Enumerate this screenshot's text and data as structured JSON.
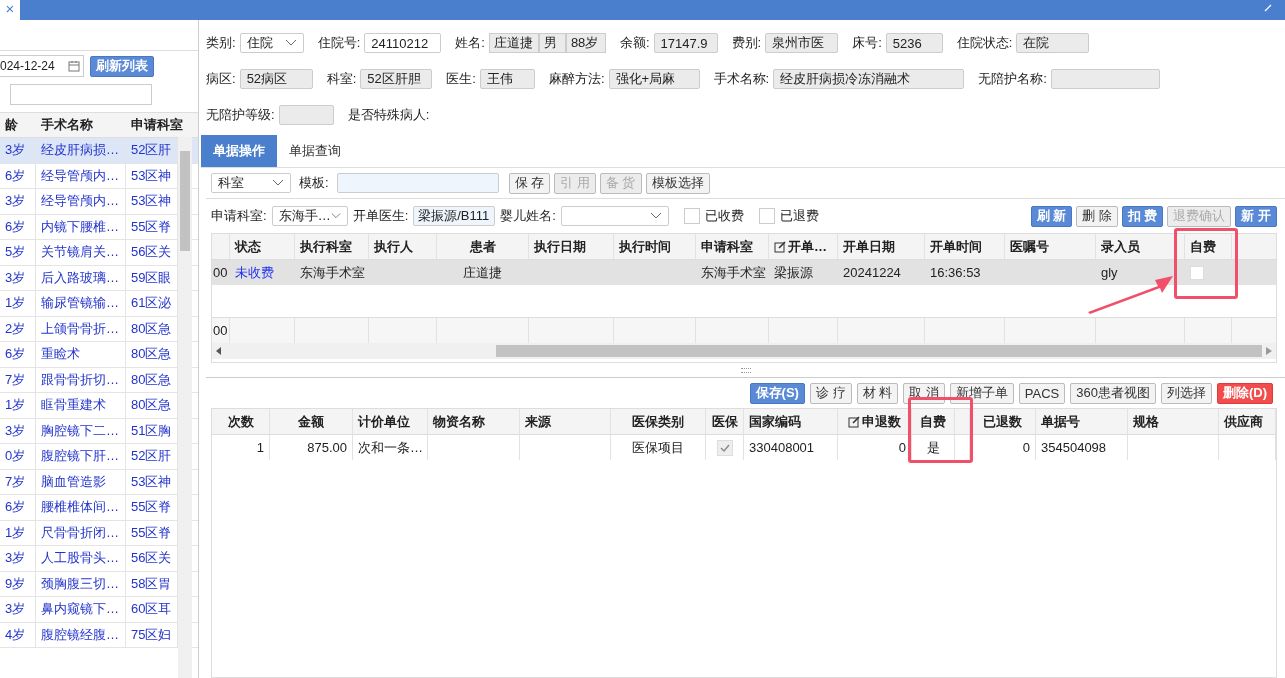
{
  "window": {
    "close_glyph": "×"
  },
  "patient_list": {
    "date": "024-12-24",
    "refresh_button": "刷新列表",
    "columns": [
      "龄",
      "手术名称",
      "申请科室"
    ],
    "rows": [
      {
        "age": "3岁",
        "name": "经皮肝病损…",
        "dept": "52区肝",
        "selected": true
      },
      {
        "age": "6岁",
        "name": "经导管颅内…",
        "dept": "53区神",
        "selected": false
      },
      {
        "age": "3岁",
        "name": "经导管颅内…",
        "dept": "53区神",
        "selected": false
      },
      {
        "age": "6岁",
        "name": "内镜下腰椎…",
        "dept": "55区脊",
        "selected": false
      },
      {
        "age": "5岁",
        "name": "关节镜肩关…",
        "dept": "56区关",
        "selected": false
      },
      {
        "age": "3岁",
        "name": "后入路玻璃…",
        "dept": "59区眼",
        "selected": false
      },
      {
        "age": "1岁",
        "name": "输尿管镜输…",
        "dept": "61区泌",
        "selected": false
      },
      {
        "age": "2岁",
        "name": "上颌骨骨折…",
        "dept": "80区急",
        "selected": false
      },
      {
        "age": "6岁",
        "name": "重睑术",
        "dept": "80区急",
        "selected": false
      },
      {
        "age": "7岁",
        "name": "跟骨骨折切…",
        "dept": "80区急",
        "selected": false
      },
      {
        "age": "1岁",
        "name": "眶骨重建术",
        "dept": "80区急",
        "selected": false
      },
      {
        "age": "3岁",
        "name": "胸腔镜下二…",
        "dept": "51区胸",
        "selected": false
      },
      {
        "age": "0岁",
        "name": "腹腔镜下肝…",
        "dept": "52区肝",
        "selected": false
      },
      {
        "age": "7岁",
        "name": "脑血管造影",
        "dept": "53区神",
        "selected": false
      },
      {
        "age": "6岁",
        "name": "腰椎椎体间…",
        "dept": "55区脊",
        "selected": false
      },
      {
        "age": "1岁",
        "name": "尺骨骨折闭…",
        "dept": "55区脊",
        "selected": false
      },
      {
        "age": "3岁",
        "name": "人工股骨头…",
        "dept": "56区关",
        "selected": false
      },
      {
        "age": "9岁",
        "name": "颈胸腹三切…",
        "dept": "58区胃",
        "selected": false
      },
      {
        "age": "3岁",
        "name": "鼻内窥镜下…",
        "dept": "60区耳",
        "selected": false
      },
      {
        "age": "4岁",
        "name": "腹腔镜经腹…",
        "dept": "75区妇",
        "selected": false
      }
    ]
  },
  "form": [
    [
      {
        "label": "类别:",
        "kind": "select",
        "value": "住院"
      },
      {
        "label": "住院号:",
        "kind": "input",
        "value": "24110212"
      },
      {
        "label": "姓名:",
        "kind": "multi",
        "values": [
          "庄道捷",
          "男",
          "88岁"
        ]
      },
      {
        "label": "余额:",
        "kind": "readonly",
        "value": "17147.9"
      },
      {
        "label": "费别:",
        "kind": "readonly",
        "value": "泉州市医"
      },
      {
        "label": "床号:",
        "kind": "readonly",
        "value": "5236"
      },
      {
        "label": "住院状态:",
        "kind": "readonly",
        "value": "在院"
      }
    ],
    [
      {
        "label": "病区:",
        "kind": "readonly",
        "value": "52病区"
      },
      {
        "label": "科室:",
        "kind": "readonly",
        "value": "52区肝胆"
      },
      {
        "label": "医生:",
        "kind": "readonly",
        "value": "王伟"
      },
      {
        "label": "麻醉方法:",
        "kind": "readonly",
        "value": "强化+局麻"
      },
      {
        "label": "手术名称:",
        "kind": "readonly",
        "value": "经皮肝病损冷冻消融术"
      },
      {
        "label": "无陪护名称:",
        "kind": "readonly"
      }
    ],
    [
      {
        "label": "无陪护等级:",
        "kind": "readonly"
      },
      {
        "label": "是否特殊病人:",
        "kind": "none"
      }
    ]
  ],
  "tabs": [
    {
      "label": "单据操作",
      "selected": true
    },
    {
      "label": "单据查询",
      "selected": false
    }
  ],
  "toolbar": {
    "scope": "科室",
    "template_label": "模板:",
    "buttons": [
      {
        "label": "保 存",
        "kind": "default",
        "disabled": false
      },
      {
        "label": "引 用",
        "kind": "default",
        "disabled": true
      },
      {
        "label": "备 货",
        "kind": "default",
        "disabled": true
      },
      {
        "label": "模板选择",
        "kind": "default",
        "disabled": false
      }
    ]
  },
  "filter": {
    "dept_label": "申请科室:",
    "dept": "东海手…",
    "doctor_label": "开单医生:",
    "doctor": "梁振源/B111",
    "baby_label": "婴儿姓名:",
    "checks": [
      {
        "label": "已收费",
        "checked": false
      },
      {
        "label": "已退费",
        "checked": false
      }
    ],
    "buttons": [
      {
        "label": "刷 新",
        "kind": "primary",
        "disabled": false
      },
      {
        "label": "删 除",
        "kind": "default",
        "disabled": false
      },
      {
        "label": "扣 费",
        "kind": "primary",
        "disabled": false
      },
      {
        "label": "退费确认",
        "kind": "default",
        "disabled": true
      },
      {
        "label": "新 开",
        "kind": "primary",
        "disabled": false
      }
    ]
  },
  "order_table": {
    "columns": [
      "",
      "状态",
      "执行科室",
      "执行人",
      "患者",
      "执行日期",
      "执行时间",
      "申请科室",
      "开单…",
      "开单日期",
      "开单时间",
      "医嘱号",
      "录入员",
      "自费"
    ],
    "rows": [
      {
        "cells": [
          "00",
          "未收费",
          "东海手术室",
          "",
          "庄道捷",
          "",
          "",
          "东海手术室",
          "梁振源",
          "20241224",
          "16:36:53",
          "",
          "gly"
        ],
        "self_pay": false
      }
    ],
    "footer": "00"
  },
  "detail_toolbar": [
    {
      "label": "保存(S)",
      "kind": "primary"
    },
    {
      "label": "诊 疗",
      "kind": "default"
    },
    {
      "label": "材 料",
      "kind": "default"
    },
    {
      "label": "取 消",
      "kind": "default"
    },
    {
      "label": "新增子单",
      "kind": "default"
    },
    {
      "label": "PACS",
      "kind": "default"
    },
    {
      "label": "360患者视图",
      "kind": "default"
    },
    {
      "label": "列选择",
      "kind": "default"
    },
    {
      "label": "删除(D)",
      "kind": "danger"
    }
  ],
  "detail_table": {
    "columns": [
      "次数",
      "金额",
      "计价单位",
      "物资名称",
      "来源",
      "医保类别",
      "医保",
      "国家编码",
      "申退数",
      "自费",
      "",
      "已退数",
      "单据号",
      "规格",
      "供应商"
    ],
    "rows": [
      {
        "cells": [
          "1",
          "875.00",
          "次和一条…",
          "",
          "",
          "医保项目",
          "",
          "330408001",
          "0",
          "是",
          "",
          "0",
          "354504098",
          "",
          ""
        ],
        "insured": true
      }
    ]
  },
  "annotations": [
    {
      "kind": "frame"
    },
    {
      "kind": "arrow"
    },
    {
      "kind": "frame"
    }
  ]
}
